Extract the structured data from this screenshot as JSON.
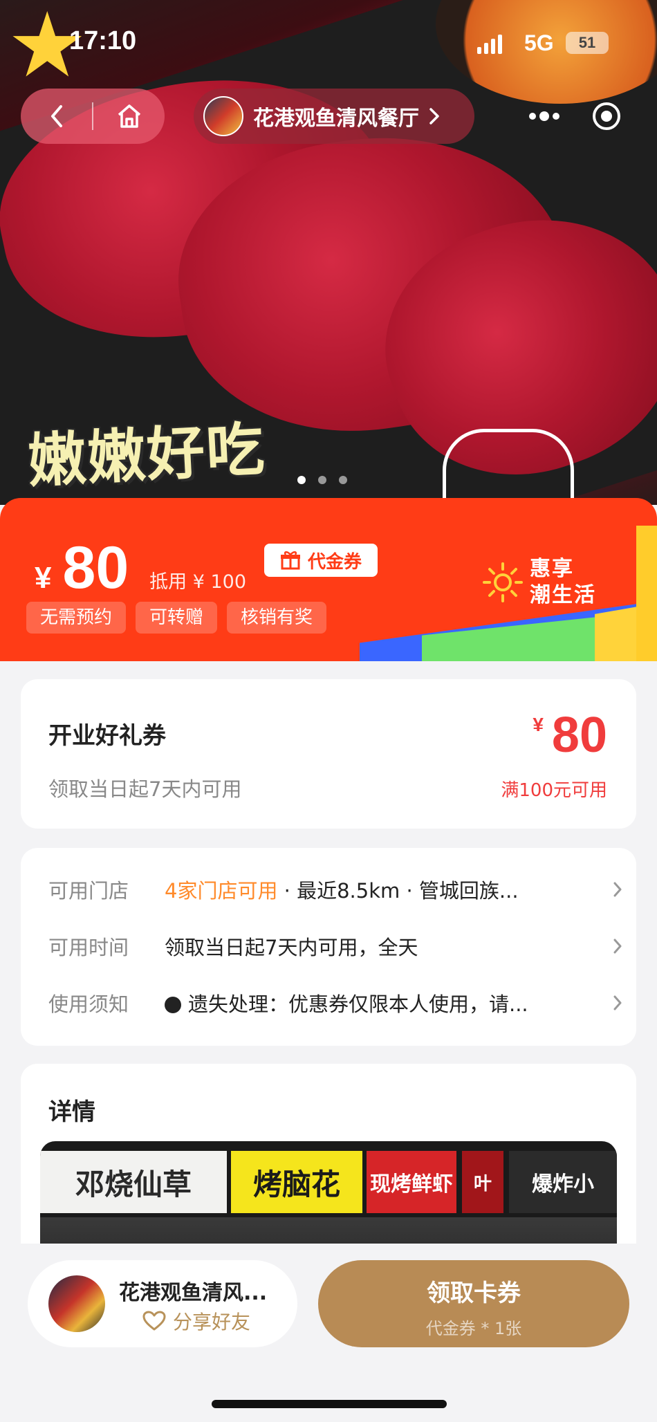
{
  "status_bar": {
    "time": "17:10",
    "network": "5G",
    "battery": "51"
  },
  "hero": {
    "caption": "嫩嫩好吃",
    "page_count": 3,
    "active_index": 0
  },
  "nav": {
    "store_name": "花港观鱼清风餐厅"
  },
  "price_banner": {
    "currency": "¥",
    "price": "80",
    "offset_text": "抵用 ¥ 100",
    "coupon_type": "代金券",
    "tags": [
      "无需预约",
      "可转赠",
      "核销有奖"
    ],
    "slogan_line1": "惠享",
    "slogan_line2": "潮生活"
  },
  "gift_card": {
    "title": "开业好礼券",
    "validity": "领取当日起7天内可用",
    "currency": "¥",
    "value": "80",
    "condition": "满100元可用"
  },
  "info": {
    "stores": {
      "label": "可用门店",
      "highlight": "4家门店可用",
      "rest": " · 最近8.5km · 管城回族..."
    },
    "time": {
      "label": "可用时间",
      "value": "领取当日起7天内可用，全天"
    },
    "notice": {
      "label": "使用须知",
      "value": "遗失处理：优惠券仅限本人使用，请..."
    }
  },
  "detail": {
    "title": "详情",
    "signs": [
      "邓烧仙草",
      "烤脑花",
      "现烤鲜虾",
      "叶",
      "爆炸小"
    ]
  },
  "bottom": {
    "store_name": "花港观鱼清风...",
    "share_label": "分享好友",
    "claim_label": "领取卡券",
    "claim_sub": "代金券 * 1张"
  },
  "colors": {
    "brand_orange": "#ff3c16",
    "price_red": "#f03c3c",
    "highlight_orange": "#ff8a2a",
    "claim_gold": "#b88b55"
  }
}
